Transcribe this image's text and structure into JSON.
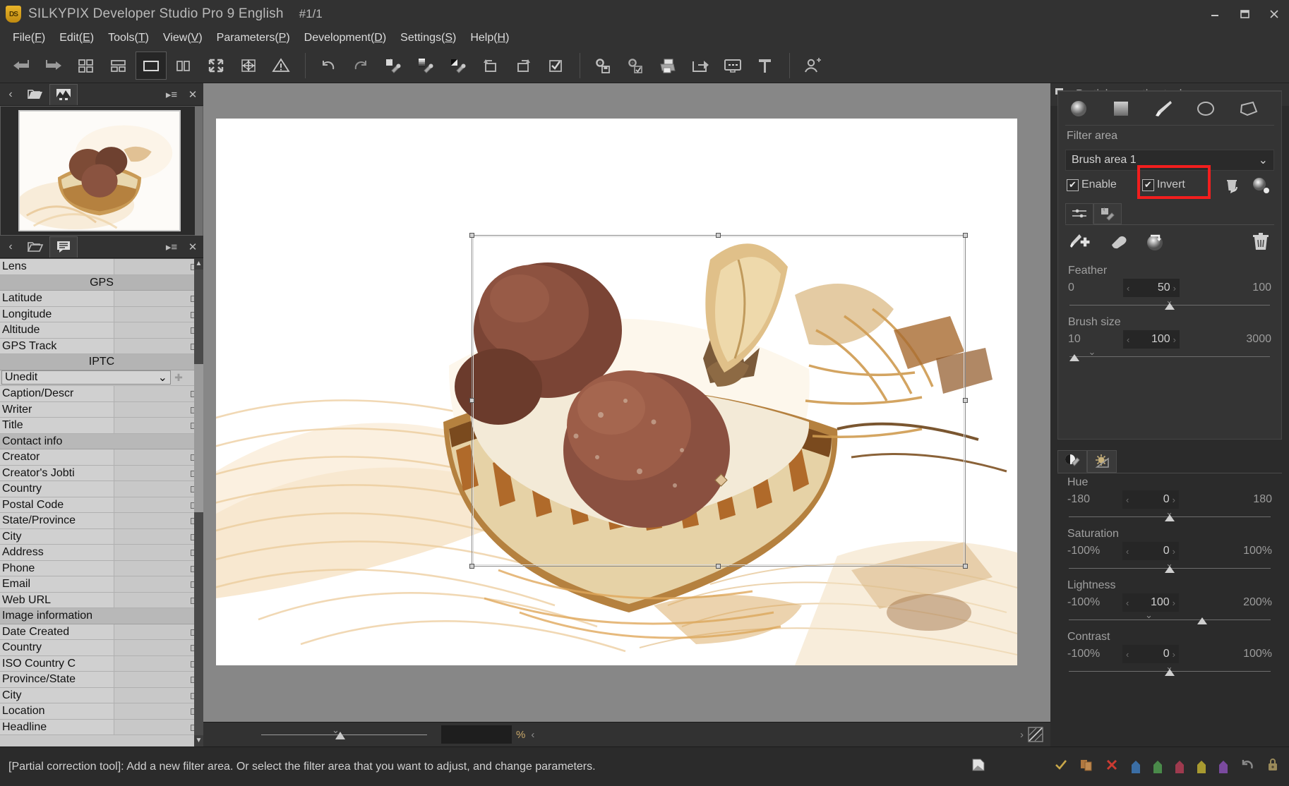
{
  "titlebar": {
    "logo_text": "DS",
    "title": "SILKYPIX Developer Studio Pro 9 English",
    "index": "#1/1",
    "minimize": "—",
    "maximize": "❐",
    "close": "✕"
  },
  "menubar": {
    "items": [
      {
        "label": "File",
        "accel": "F"
      },
      {
        "label": "Edit",
        "accel": "E"
      },
      {
        "label": "Tools",
        "accel": "T"
      },
      {
        "label": "View",
        "accel": "V"
      },
      {
        "label": "Parameters",
        "accel": "P"
      },
      {
        "label": "Development",
        "accel": "D"
      },
      {
        "label": "Settings",
        "accel": "S"
      },
      {
        "label": "Help",
        "accel": "H"
      }
    ]
  },
  "toolbar": {
    "items": [
      {
        "name": "previous-image-icon",
        "selected": false
      },
      {
        "name": "next-image-icon",
        "selected": false
      },
      {
        "name": "thumbnail-grid-view-icon",
        "selected": false
      },
      {
        "name": "thumbnail-list-view-icon",
        "selected": false
      },
      {
        "name": "single-image-view-icon",
        "selected": true
      },
      {
        "name": "two-pane-compare-icon",
        "selected": false
      },
      {
        "name": "fullscreen-icon",
        "selected": false
      },
      {
        "name": "fit-to-window-icon",
        "selected": false
      },
      {
        "name": "warning-icon",
        "selected": false
      },
      {
        "name": "undo-icon",
        "selected": false
      },
      {
        "name": "redo-icon",
        "selected": false
      },
      {
        "name": "white-balance-picker-icon",
        "selected": false
      },
      {
        "name": "gray-balance-picker-icon",
        "selected": false
      },
      {
        "name": "black-balance-picker-icon",
        "selected": false
      },
      {
        "name": "rotate-left-icon",
        "selected": false
      },
      {
        "name": "rotate-right-icon",
        "selected": false
      },
      {
        "name": "mark-checkbox-icon",
        "selected": false
      },
      {
        "name": "develop-save-icon",
        "selected": false
      },
      {
        "name": "batch-develop-icon",
        "selected": false
      },
      {
        "name": "print-icon",
        "selected": false
      },
      {
        "name": "export-icon",
        "selected": false
      },
      {
        "name": "slideshow-icon",
        "selected": false
      },
      {
        "name": "crop-tool-icon",
        "selected": false
      },
      {
        "name": "user-profile-icon",
        "selected": false
      }
    ]
  },
  "thumbnail_pane": {
    "back_label": "‹",
    "tabs": [
      {
        "name": "folder-explorer-tab",
        "active": false
      },
      {
        "name": "thumbnail-tab",
        "active": true
      }
    ],
    "menu_icon": "▸≡",
    "close_icon": "✕"
  },
  "metadata_pane": {
    "back_label": "‹",
    "tabs": [
      {
        "name": "folder-tab",
        "active": false
      },
      {
        "name": "metadata-tab",
        "active": true
      }
    ],
    "menu_icon": "▸≡",
    "close_icon": "✕",
    "rows": [
      {
        "type": "field",
        "key": "Lens",
        "value": ""
      },
      {
        "type": "section",
        "key": "GPS"
      },
      {
        "type": "field",
        "key": "Latitude",
        "value": ""
      },
      {
        "type": "field2",
        "key": "Longitude",
        "value": ""
      },
      {
        "type": "field",
        "key": "Altitude",
        "value": ""
      },
      {
        "type": "field",
        "key": "GPS Track",
        "value": ""
      },
      {
        "type": "section",
        "key": "IPTC"
      },
      {
        "type": "combo",
        "key": "Unedit",
        "value": "Unedit"
      },
      {
        "type": "field",
        "key": "Caption/Descr",
        "value": ""
      },
      {
        "type": "field",
        "key": "Writer",
        "value": ""
      },
      {
        "type": "field",
        "key": "Title",
        "value": ""
      },
      {
        "type": "group",
        "key": "Contact info"
      },
      {
        "type": "field",
        "key": "Creator",
        "value": ""
      },
      {
        "type": "field",
        "key": "Creator's Jobti",
        "value": ""
      },
      {
        "type": "field",
        "key": "Country",
        "value": ""
      },
      {
        "type": "field",
        "key": "Postal Code",
        "value": ""
      },
      {
        "type": "field",
        "key": "State/Province",
        "value": ""
      },
      {
        "type": "field",
        "key": "City",
        "value": ""
      },
      {
        "type": "field",
        "key": "Address",
        "value": ""
      },
      {
        "type": "field",
        "key": "Phone",
        "value": ""
      },
      {
        "type": "field",
        "key": "Email",
        "value": ""
      },
      {
        "type": "field",
        "key": "Web URL",
        "value": ""
      },
      {
        "type": "group",
        "key": "Image information"
      },
      {
        "type": "field",
        "key": "Date Created",
        "value": ""
      },
      {
        "type": "field",
        "key": "Country",
        "value": ""
      },
      {
        "type": "field",
        "key": "ISO Country C",
        "value": ""
      },
      {
        "type": "field",
        "key": "Province/State",
        "value": ""
      },
      {
        "type": "field",
        "key": "City",
        "value": ""
      },
      {
        "type": "field",
        "key": "Location",
        "value": ""
      },
      {
        "type": "field",
        "key": "Headline",
        "value": ""
      }
    ]
  },
  "viewer": {
    "zoom_percent_symbol": "%",
    "zoom_value": "",
    "prev_arrow": "‹",
    "next_arrow": "›"
  },
  "right_panel": {
    "title": "Partial correction tool",
    "menu_icon": "▸≡",
    "close_icon": "✕",
    "shapes": [
      {
        "name": "gradient-circle-tool-icon",
        "selected": false
      },
      {
        "name": "gradient-rectangle-tool-icon",
        "selected": false
      },
      {
        "name": "brush-tool-icon",
        "selected": true
      },
      {
        "name": "ellipse-tool-icon",
        "selected": false
      },
      {
        "name": "polygon-tool-icon",
        "selected": false
      }
    ],
    "filter_area_label": "Filter area",
    "filter_area_icons": [
      {
        "name": "reset-filter-area-icon"
      },
      {
        "name": "show-filter-mask-icon"
      }
    ],
    "selected_area": "Brush area 1",
    "dropdown_caret": "⌄",
    "enable": {
      "label": "Enable",
      "checked": true,
      "mark": "✔"
    },
    "invert": {
      "label": "Invert",
      "checked": true,
      "mark": "✔",
      "highlighted": true
    },
    "mini_tabs": [
      {
        "name": "brush-settings-tab",
        "active": true
      },
      {
        "name": "mask-settings-tab",
        "active": false
      }
    ],
    "brush_tools": [
      {
        "name": "add-brush-icon"
      },
      {
        "name": "eraser-icon"
      },
      {
        "name": "invert-mask-icon"
      },
      {
        "name": "delete-area-icon"
      }
    ],
    "sliders_brush": [
      {
        "label": "Feather",
        "min": "0",
        "value": "50",
        "max": "100",
        "knob_pct": 50
      },
      {
        "label": "Brush size",
        "min": "10",
        "value": "100",
        "max": "3000",
        "knob_pct": 3
      }
    ],
    "adjust_tabs": [
      {
        "name": "color-adjust-tab",
        "active": true
      },
      {
        "name": "exposure-adjust-tab",
        "active": false
      }
    ],
    "sliders_adjust": [
      {
        "label": "Hue",
        "min": "-180",
        "value": "0",
        "max": "180",
        "knob_pct": 50
      },
      {
        "label": "Saturation",
        "min": "-100%",
        "value": "0",
        "max": "100%",
        "knob_pct": 50
      },
      {
        "label": "Lightness",
        "min": "-100%",
        "value": "100",
        "max": "200%",
        "knob_pct": 66
      },
      {
        "label": "Contrast",
        "min": "-100%",
        "value": "0",
        "max": "100%",
        "knob_pct": 50
      }
    ]
  },
  "statusbar": {
    "message": "[Partial correction tool]: Add a new filter area. Or select the filter area that you want to adjust, and change parameters.",
    "icons": [
      {
        "name": "page-corner-icon",
        "color": "#d8d8d8"
      },
      {
        "name": "check-mark-icon",
        "color": "#c9a84a"
      },
      {
        "name": "copy-icon",
        "color": "#b07840"
      },
      {
        "name": "delete-x-icon",
        "color": "#cc3b32"
      },
      {
        "name": "blue-tag-icon",
        "color": "#3b6ea5"
      },
      {
        "name": "green-tag-icon",
        "color": "#4a8a4a"
      },
      {
        "name": "red-tag-icon",
        "color": "#9e3a4e"
      },
      {
        "name": "yellow-tag-icon",
        "color": "#a89a30"
      },
      {
        "name": "purple-tag-icon",
        "color": "#7a4a9e"
      },
      {
        "name": "undo-tag-icon",
        "color": "#8a8a8a"
      },
      {
        "name": "lock-icon",
        "color": "#9a8a5a"
      }
    ]
  },
  "colors": {
    "accent_red": "#f21e1e",
    "panel_bg": "#2b2b2b",
    "chrome_bg": "#323232",
    "canvas_bg": "#878787",
    "metadata_bg": "#c8c8c8"
  }
}
